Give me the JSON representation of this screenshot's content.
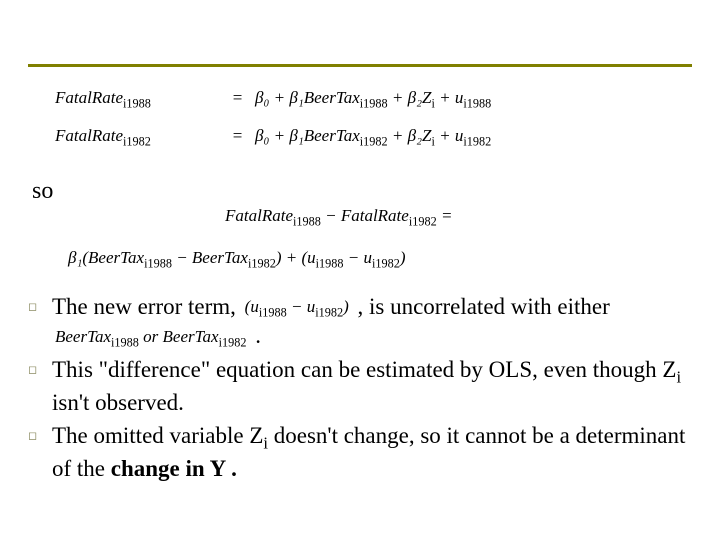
{
  "eq1": {
    "lhs": "FatalRate",
    "lhs_sub": "i1988",
    "rhs": "β₀ + β₁BeerTax",
    "rhs_sub1": "i1988",
    "rhs2": " + β₂Z",
    "rhs_sub2": "i",
    "rhs3": " + u",
    "rhs_sub3": "i1988"
  },
  "eq2": {
    "lhs": "FatalRate",
    "lhs_sub": "i1982",
    "rhs": "β₀ + β₁BeerTax",
    "rhs_sub1": "i1982",
    "rhs2": " + β₂Z",
    "rhs_sub2": "i",
    "rhs3": " + u",
    "rhs_sub3": "i1982"
  },
  "so": "so",
  "eq3": {
    "p1": "FatalRate",
    "s1": "i1988",
    "p2": " − FatalRate",
    "s2": "i1982",
    "p3": " ="
  },
  "eq4": {
    "p1": "β₁(BeerTax",
    "s1": "i1988",
    "p2": " − BeerTax",
    "s2": "i1982",
    "p3": ") + (u",
    "s3": "i1988",
    "p4": " − u",
    "s4": "i1982",
    "p5": ")"
  },
  "b1": {
    "t1": "The new error term, ",
    "m1a": "(u",
    "m1s1": "i1988",
    "m1b": " − u",
    "m1s2": "i1982",
    "m1c": ")",
    "t2": " , is uncorrelated with either ",
    "m2a": "BeerTax",
    "m2s1": "i1988",
    "m2b": " or BeerTax",
    "m2s2": "i1982",
    "t3": "  ."
  },
  "b2": {
    "t1": "This \"difference\" equation can be estimated by OLS, even though Z",
    "s1": "i",
    "t2": " isn't observed."
  },
  "b3": {
    "t1": "The omitted variable Z",
    "s1": "i",
    "t2": " doesn't change, so it cannot be a determinant of the ",
    "bold": "change in Y .",
    "t3": ""
  }
}
